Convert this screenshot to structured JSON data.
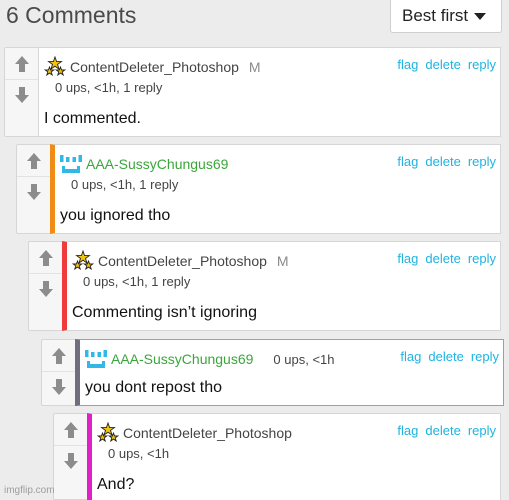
{
  "header": {
    "title": "6 Comments",
    "sort_label": "Best first"
  },
  "colors": {
    "link": "#1fb3e0",
    "green_user": "#3aa63a",
    "accent_orange": "#f08c16",
    "accent_red": "#ee3b3b",
    "accent_slate": "#6e6e7e",
    "accent_magenta": "#e020c8"
  },
  "icons": {
    "upvote": "arrow-up-icon",
    "downvote": "arrow-down-icon",
    "avatar_stars": "stars-avatar-icon",
    "avatar_smiley": "smiley-avatar-icon"
  },
  "actions": {
    "flag": "flag",
    "delete": "delete",
    "reply": "reply"
  },
  "comments": [
    {
      "user": "ContentDeleter_Photoshop",
      "badge": "M",
      "meta": "0 ups, <1h, 1 reply",
      "text": "I commented."
    },
    {
      "user": "AAA-SussyChungus69",
      "meta": "0 ups, <1h, 1 reply",
      "text": "you ignored tho"
    },
    {
      "user": "ContentDeleter_Photoshop",
      "badge": "M",
      "meta": "0 ups, <1h, 1 reply",
      "text": "Commenting isn’t ignoring"
    },
    {
      "user": "AAA-SussyChungus69",
      "meta": "0 ups, <1h",
      "text": "you dont repost tho"
    },
    {
      "user": "ContentDeleter_Photoshop",
      "meta": "0 ups, <1h",
      "text": "And?"
    }
  ],
  "watermark": "imgflip.com"
}
